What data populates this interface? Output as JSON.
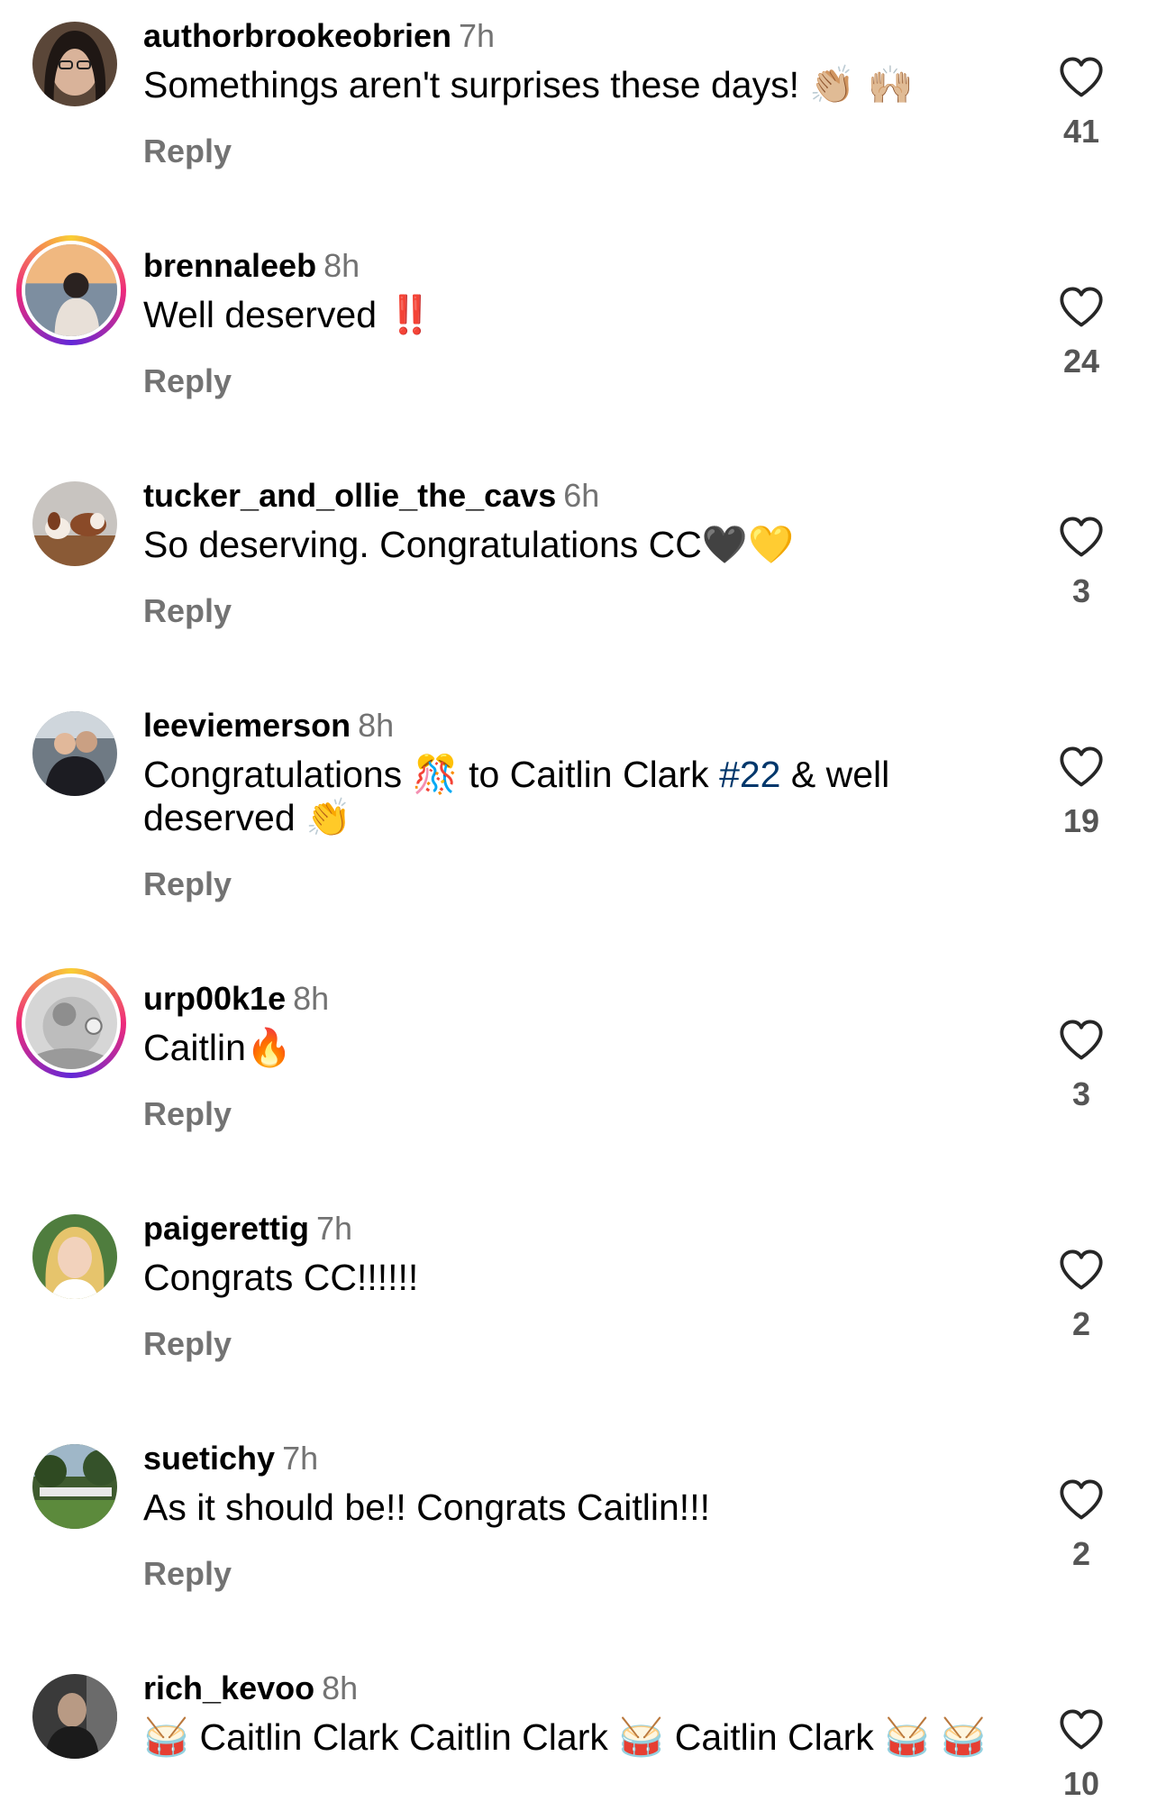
{
  "comments": [
    {
      "username": "authorbrookeobrien",
      "time": "7h",
      "text": "Somethings aren't surprises these days!",
      "emoji": "👏🏼 🙌🏼",
      "reply": "Reply",
      "likes": "41"
    },
    {
      "username": "brennaleeb",
      "time": "8h",
      "text": "Well deserved",
      "emoji": "‼️",
      "reply": "Reply",
      "likes": "24"
    },
    {
      "username": "tucker_and_ollie_the_cavs",
      "time": "6h",
      "text": "So deserving. Congratulations CC",
      "emoji": "🖤💛",
      "reply": "Reply",
      "likes": "3"
    },
    {
      "username": "leeviemerson",
      "time": "8h",
      "text_a": "Congratulations",
      "emoji_a": "🎊",
      "text_b": "to Caitlin Clark",
      "hashtag": "#22",
      "text_c": "& well deserved",
      "emoji_b": "👏",
      "reply": "Reply",
      "likes": "19"
    },
    {
      "username": "urp00k1e",
      "time": "8h",
      "text": "Caitlin",
      "emoji": "🔥",
      "reply": "Reply",
      "likes": "3"
    },
    {
      "username": "paigerettig",
      "time": "7h",
      "text": "Congrats CC!!!!!!",
      "reply": "Reply",
      "likes": "2"
    },
    {
      "username": "suetichy",
      "time": "7h",
      "text": "As it should be!! Congrats Caitlin!!!",
      "reply": "Reply",
      "likes": "2"
    },
    {
      "username": "rich_kevoo",
      "time": "8h",
      "emoji": "🥁",
      "text_a": "Caitlin Clark Caitlin Clark",
      "text_b": "Caitlin Clark",
      "likes": "10"
    }
  ],
  "colors": {
    "username": "#000000",
    "muted": "#737373",
    "hashtag": "#00376b",
    "story_ring": [
      "#f9ce34",
      "#ee2a7b",
      "#6228d7"
    ]
  },
  "icons": {
    "like": "heart-outline-icon"
  }
}
